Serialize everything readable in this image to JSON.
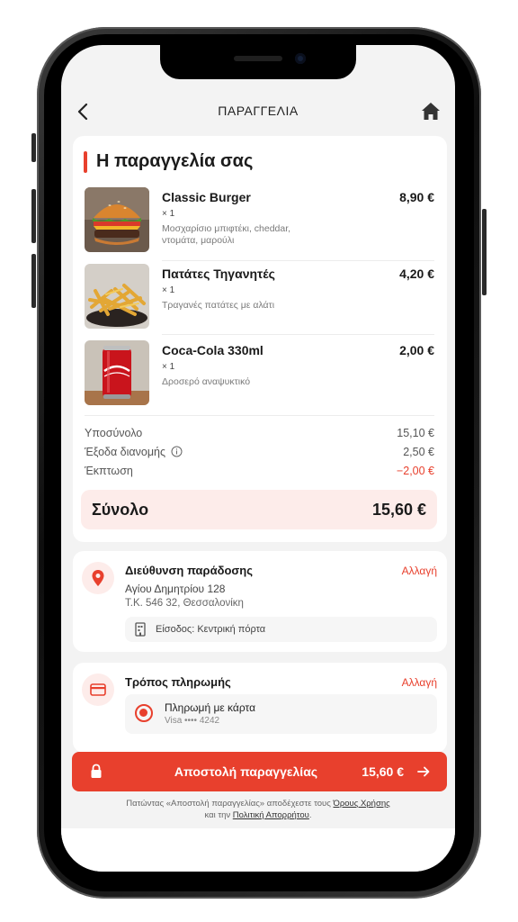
{
  "header": {
    "title": "ΠΑΡΑΓΓΕΛΙΑ",
    "back_icon": "chevron-left-icon",
    "home_icon": "home-icon"
  },
  "order": {
    "title": "Η παραγγελία σας",
    "items": [
      {
        "name": "Classic Burger",
        "qty": "× 1",
        "desc": "Μοσχαρίσιο μπιφτέκι, cheddar, ντομάτα, μαρούλι",
        "price": "8,90 €"
      },
      {
        "name": "Πατάτες Τηγανητές",
        "qty": "× 1",
        "desc": "Τραγανές πατάτες με αλάτι",
        "price": "4,20 €"
      },
      {
        "name": "Coca-Cola 330ml",
        "qty": "× 1",
        "desc": "Δροσερό αναψυκτικό",
        "price": "2,00 €"
      }
    ],
    "subtotal_label": "Υποσύνολο",
    "subtotal_value": "15,10 €",
    "delivery_label": "Έξοδα διανομής",
    "delivery_value": "2,50 €",
    "discount_label": "Έκπτωση",
    "discount_value": "−2,00 €",
    "total_label": "Σύνολο",
    "total_value": "15,60 €"
  },
  "address": {
    "title": "Διεύθυνση παράδοσης",
    "change": "Αλλαγή",
    "street": "Αγίου Δημητρίου 128",
    "city": "Τ.Κ. 546 32, Θεσσαλονίκη",
    "entrance": "Είσοδος: Κεντρική πόρτα"
  },
  "payment": {
    "title": "Τρόπος πληρωμής",
    "change": "Αλλαγή",
    "method": "Πληρωμή με κάρτα",
    "card": "Visa •••• 4242"
  },
  "submit": {
    "label": "Αποστολή παραγγελίας",
    "price": "15,60 €"
  },
  "terms": {
    "text1": "Πατώντας «Αποστολή παραγγελίας» αποδέχεστε τους",
    "link1": "Όρους Χρήσης",
    "text2": "και την",
    "link2": "Πολιτική Απορρήτου",
    "text3": "."
  },
  "colors": {
    "accent": "#e8402d",
    "accent_light": "#fdecea",
    "background": "#f3f3f3"
  }
}
